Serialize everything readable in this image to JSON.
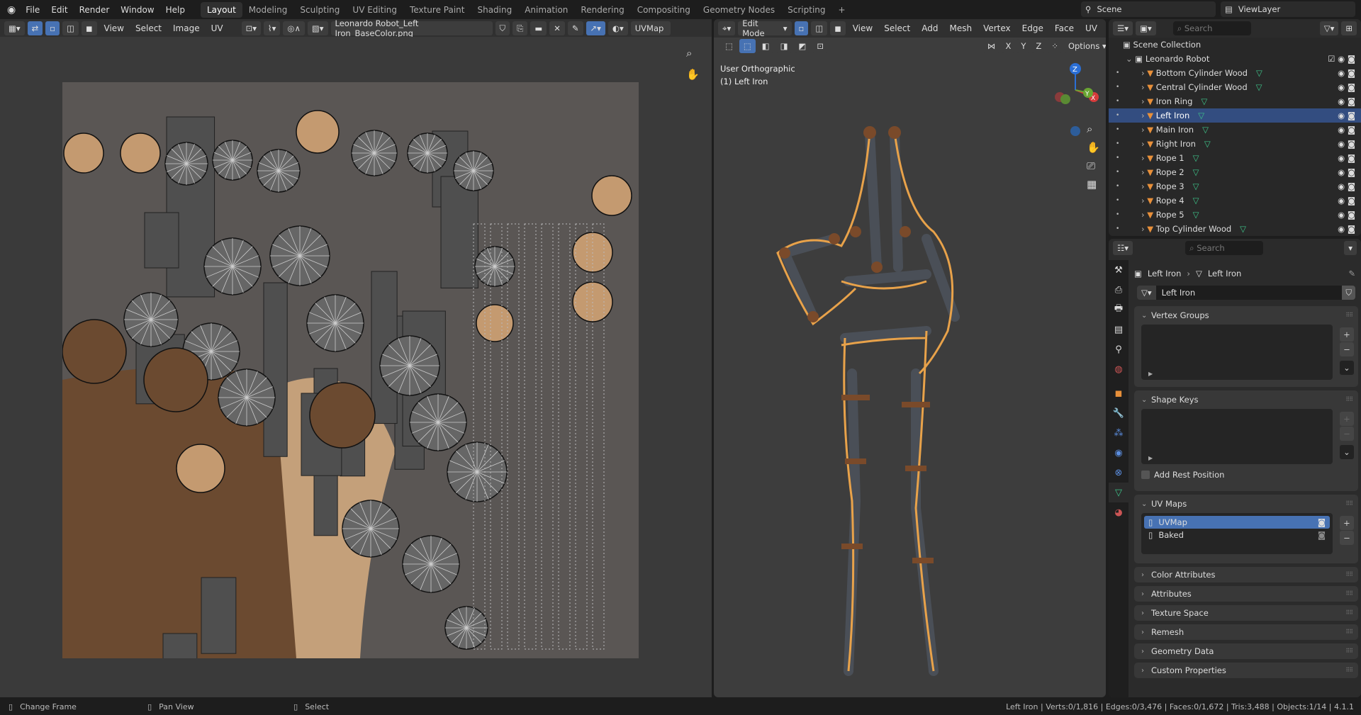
{
  "menu": [
    "File",
    "Edit",
    "Render",
    "Window",
    "Help"
  ],
  "workspaces": [
    "Layout",
    "Modeling",
    "Sculpting",
    "UV Editing",
    "Texture Paint",
    "Shading",
    "Animation",
    "Rendering",
    "Compositing",
    "Geometry Nodes",
    "Scripting"
  ],
  "scene": "Scene",
  "view_layer": "ViewLayer",
  "uv_editor": {
    "menus": [
      "View",
      "Select",
      "Image",
      "UV"
    ],
    "image_name": "Leonardo Robot_Left Iron_BaseColor.png",
    "uv_map": "UVMap"
  },
  "viewport": {
    "mode": "Edit Mode",
    "menus": [
      "View",
      "Select",
      "Add",
      "Mesh",
      "Vertex",
      "Edge",
      "Face",
      "UV"
    ],
    "axes": [
      "X",
      "Y",
      "Z"
    ],
    "options": "Options",
    "view_name": "User Orthographic",
    "object_label": "(1) Left Iron"
  },
  "outliner": {
    "search_placeholder": "Search",
    "scene_collection": "Scene Collection",
    "collection": "Leonardo Robot",
    "items": [
      {
        "name": "Bottom Cylinder Wood",
        "selected": false
      },
      {
        "name": "Central Cylinder Wood",
        "selected": false
      },
      {
        "name": "Iron Ring",
        "selected": false
      },
      {
        "name": "Left Iron",
        "selected": true
      },
      {
        "name": "Main Iron",
        "selected": false
      },
      {
        "name": "Right Iron",
        "selected": false
      },
      {
        "name": "Rope 1",
        "selected": false
      },
      {
        "name": "Rope 2",
        "selected": false
      },
      {
        "name": "Rope 3",
        "selected": false
      },
      {
        "name": "Rope 4",
        "selected": false
      },
      {
        "name": "Rope 5",
        "selected": false
      },
      {
        "name": "Top Cylinder Wood",
        "selected": false
      }
    ]
  },
  "properties": {
    "search_placeholder": "Search",
    "breadcrumb_object": "Left Iron",
    "breadcrumb_mesh": "Left Iron",
    "mesh_name": "Left Iron",
    "vertex_groups": "Vertex Groups",
    "shape_keys": "Shape Keys",
    "add_rest_position": "Add Rest Position",
    "uv_maps": "UV Maps",
    "uv_map_list": [
      "UVMap",
      "Baked"
    ],
    "collapsed_panels": [
      "Color Attributes",
      "Attributes",
      "Texture Space",
      "Remesh",
      "Geometry Data",
      "Custom Properties"
    ]
  },
  "status": {
    "hints": [
      "Change Frame",
      "Pan View",
      "Select"
    ],
    "stats": "Left Iron | Verts:0/1,816 | Edges:0/3,476 | Faces:0/1,672 | Tris:3,488 | Objects:1/14 | 4.1.1"
  },
  "colors": {
    "accent": "#4772b3",
    "selection": "#334d80",
    "orange": "#e8a24a"
  }
}
